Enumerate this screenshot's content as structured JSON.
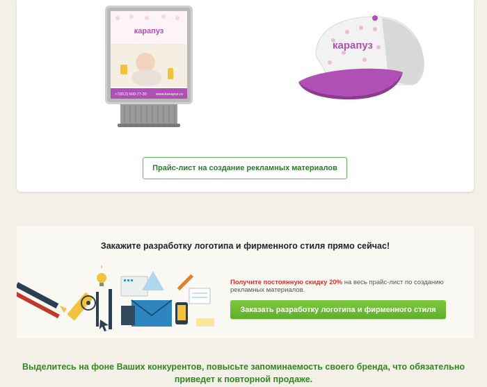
{
  "top_card": {
    "stand": {
      "brand": "карапуз",
      "phone": "+7(812) 600-77-30",
      "site": "www.karapuz.ru"
    },
    "cap": {
      "brand": "карапуз",
      "colors": {
        "visor": "#b04fb5",
        "body": "#f2f2f2"
      }
    },
    "price_button": "Прайс-лист на создание рекламных материалов"
  },
  "order_section": {
    "title": "Закажите разработку логотипа и фирменного стиля прямо сейчас!",
    "promo_before": "Получите постоянную скидку 20%",
    "promo_after": " на весь прайс-лист по созданию рекламных материалов.",
    "button": "Заказать разработку логотипа и фирменного стиля"
  },
  "slogan": {
    "line1": "Выделитесь на фоне Ваших конкурентов, повысьте запоминаемость своего бренда, что обязательно",
    "line2": "приведет к повторной продаже."
  },
  "colors": {
    "background": "#f3f0e8",
    "accent_green": "#5fae2c",
    "promo_red": "#d9342b",
    "slogan_green": "#2e8a1e"
  }
}
